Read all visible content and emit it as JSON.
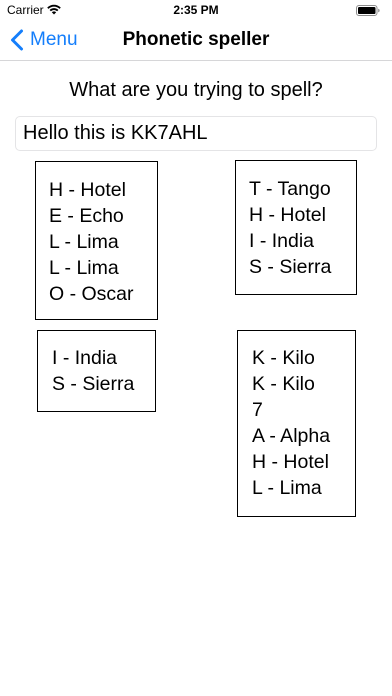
{
  "status_bar": {
    "carrier": "Carrier",
    "time": "2:35 PM",
    "icons": [
      "wifi-icon",
      "battery-icon"
    ]
  },
  "nav": {
    "back_label": "Menu",
    "back_icon": "chevron-left-icon",
    "title": "Phonetic speller",
    "accent_color": "#147efb"
  },
  "prompt": "What are you trying to spell?",
  "input": {
    "value": "Hello this is KK7AHL",
    "placeholder": ""
  },
  "words": [
    {
      "lines": [
        "H - Hotel",
        "E - Echo",
        "L - Lima",
        "L - Lima",
        "O - Oscar"
      ]
    },
    {
      "lines": [
        "T - Tango",
        "H - Hotel",
        "I - India",
        "S - Sierra"
      ]
    },
    {
      "lines": [
        "I - India",
        "S - Sierra"
      ]
    },
    {
      "lines": [
        "K - Kilo",
        "K - Kilo",
        "7",
        "A - Alpha",
        "H - Hotel",
        "L - Lima"
      ]
    }
  ]
}
